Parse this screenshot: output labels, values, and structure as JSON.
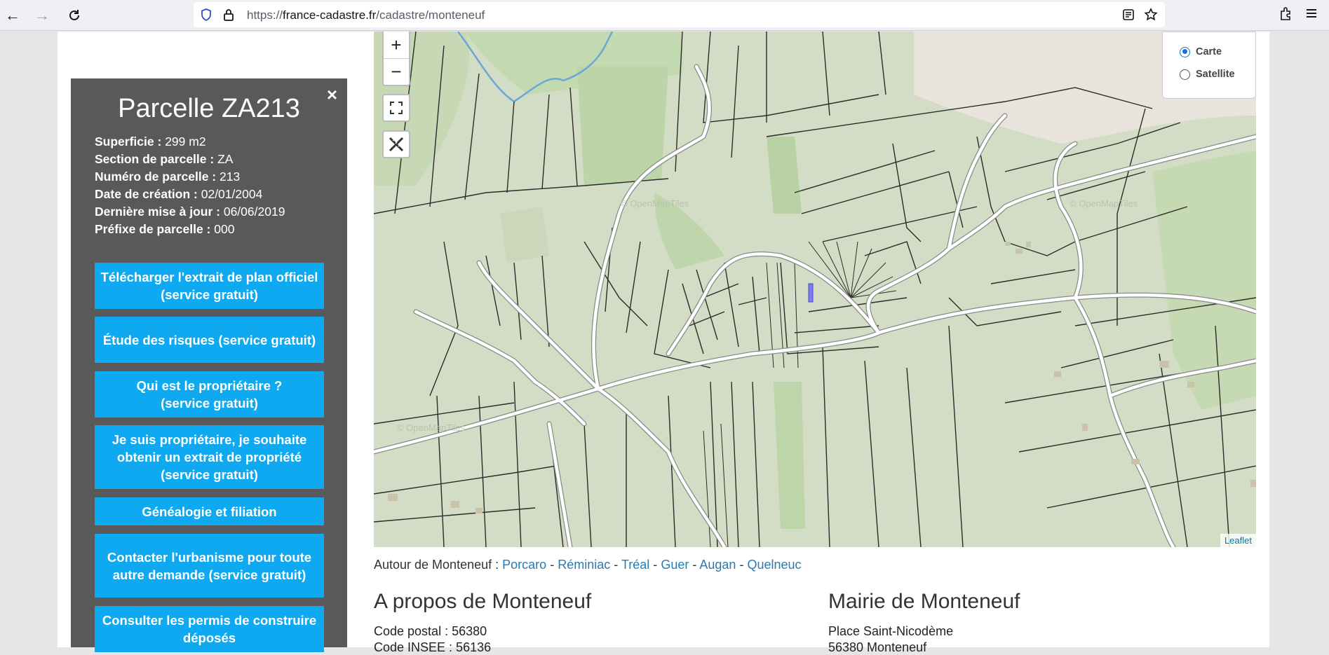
{
  "browser": {
    "url_prefix": "https://",
    "url_host": "france-cadastre.fr",
    "url_path": "/cadastre/monteneuf"
  },
  "panel": {
    "title": "Parcelle ZA213",
    "close_glyph": "×",
    "fields": [
      {
        "label": "Superficie :",
        "value": "299 m2"
      },
      {
        "label": "Section de parcelle :",
        "value": "ZA"
      },
      {
        "label": "Numéro de parcelle :",
        "value": "213"
      },
      {
        "label": "Date de création :",
        "value": "02/01/2004"
      },
      {
        "label": "Dernière mise à jour :",
        "value": "06/06/2019"
      },
      {
        "label": "Préfixe de parcelle :",
        "value": "000"
      }
    ],
    "buttons": [
      "Télécharger l'extrait de plan officiel (service gratuit)",
      "Étude des risques (service gratuit)",
      "Qui est le propriétaire ? (service gratuit)",
      "Je suis propriétaire, je souhaite obtenir un extrait de propriété (service gratuit)",
      "Généalogie et filiation",
      "Contacter l'urbanisme pour toute autre demande (service gratuit)",
      "Consulter les permis de construire déposés"
    ]
  },
  "map": {
    "zoom_in": "+",
    "zoom_out": "−",
    "layers": {
      "carte": "Carte",
      "satellite": "Satellite",
      "selected": "Carte"
    },
    "watermark": "© OpenMapTiles",
    "attribution": "Leaflet"
  },
  "around": {
    "label": "Autour de Monteneuf :",
    "towns": [
      "Porcaro",
      "Réminiac",
      "Tréal",
      "Guer",
      "Augan",
      "Quelneuc"
    ]
  },
  "about": {
    "title": "A propos de Monteneuf",
    "postal": "Code postal : 56380",
    "insee": "Code INSEE : 56136"
  },
  "mairie": {
    "title": "Mairie de Monteneuf",
    "line1": "Place Saint-Nicodème",
    "line2": "56380 Monteneuf"
  },
  "colors": {
    "panel_bg": "#595959",
    "button_bg": "#0fa9f2",
    "link": "#2a7ab0",
    "map_bg": "#d3dcc5"
  }
}
